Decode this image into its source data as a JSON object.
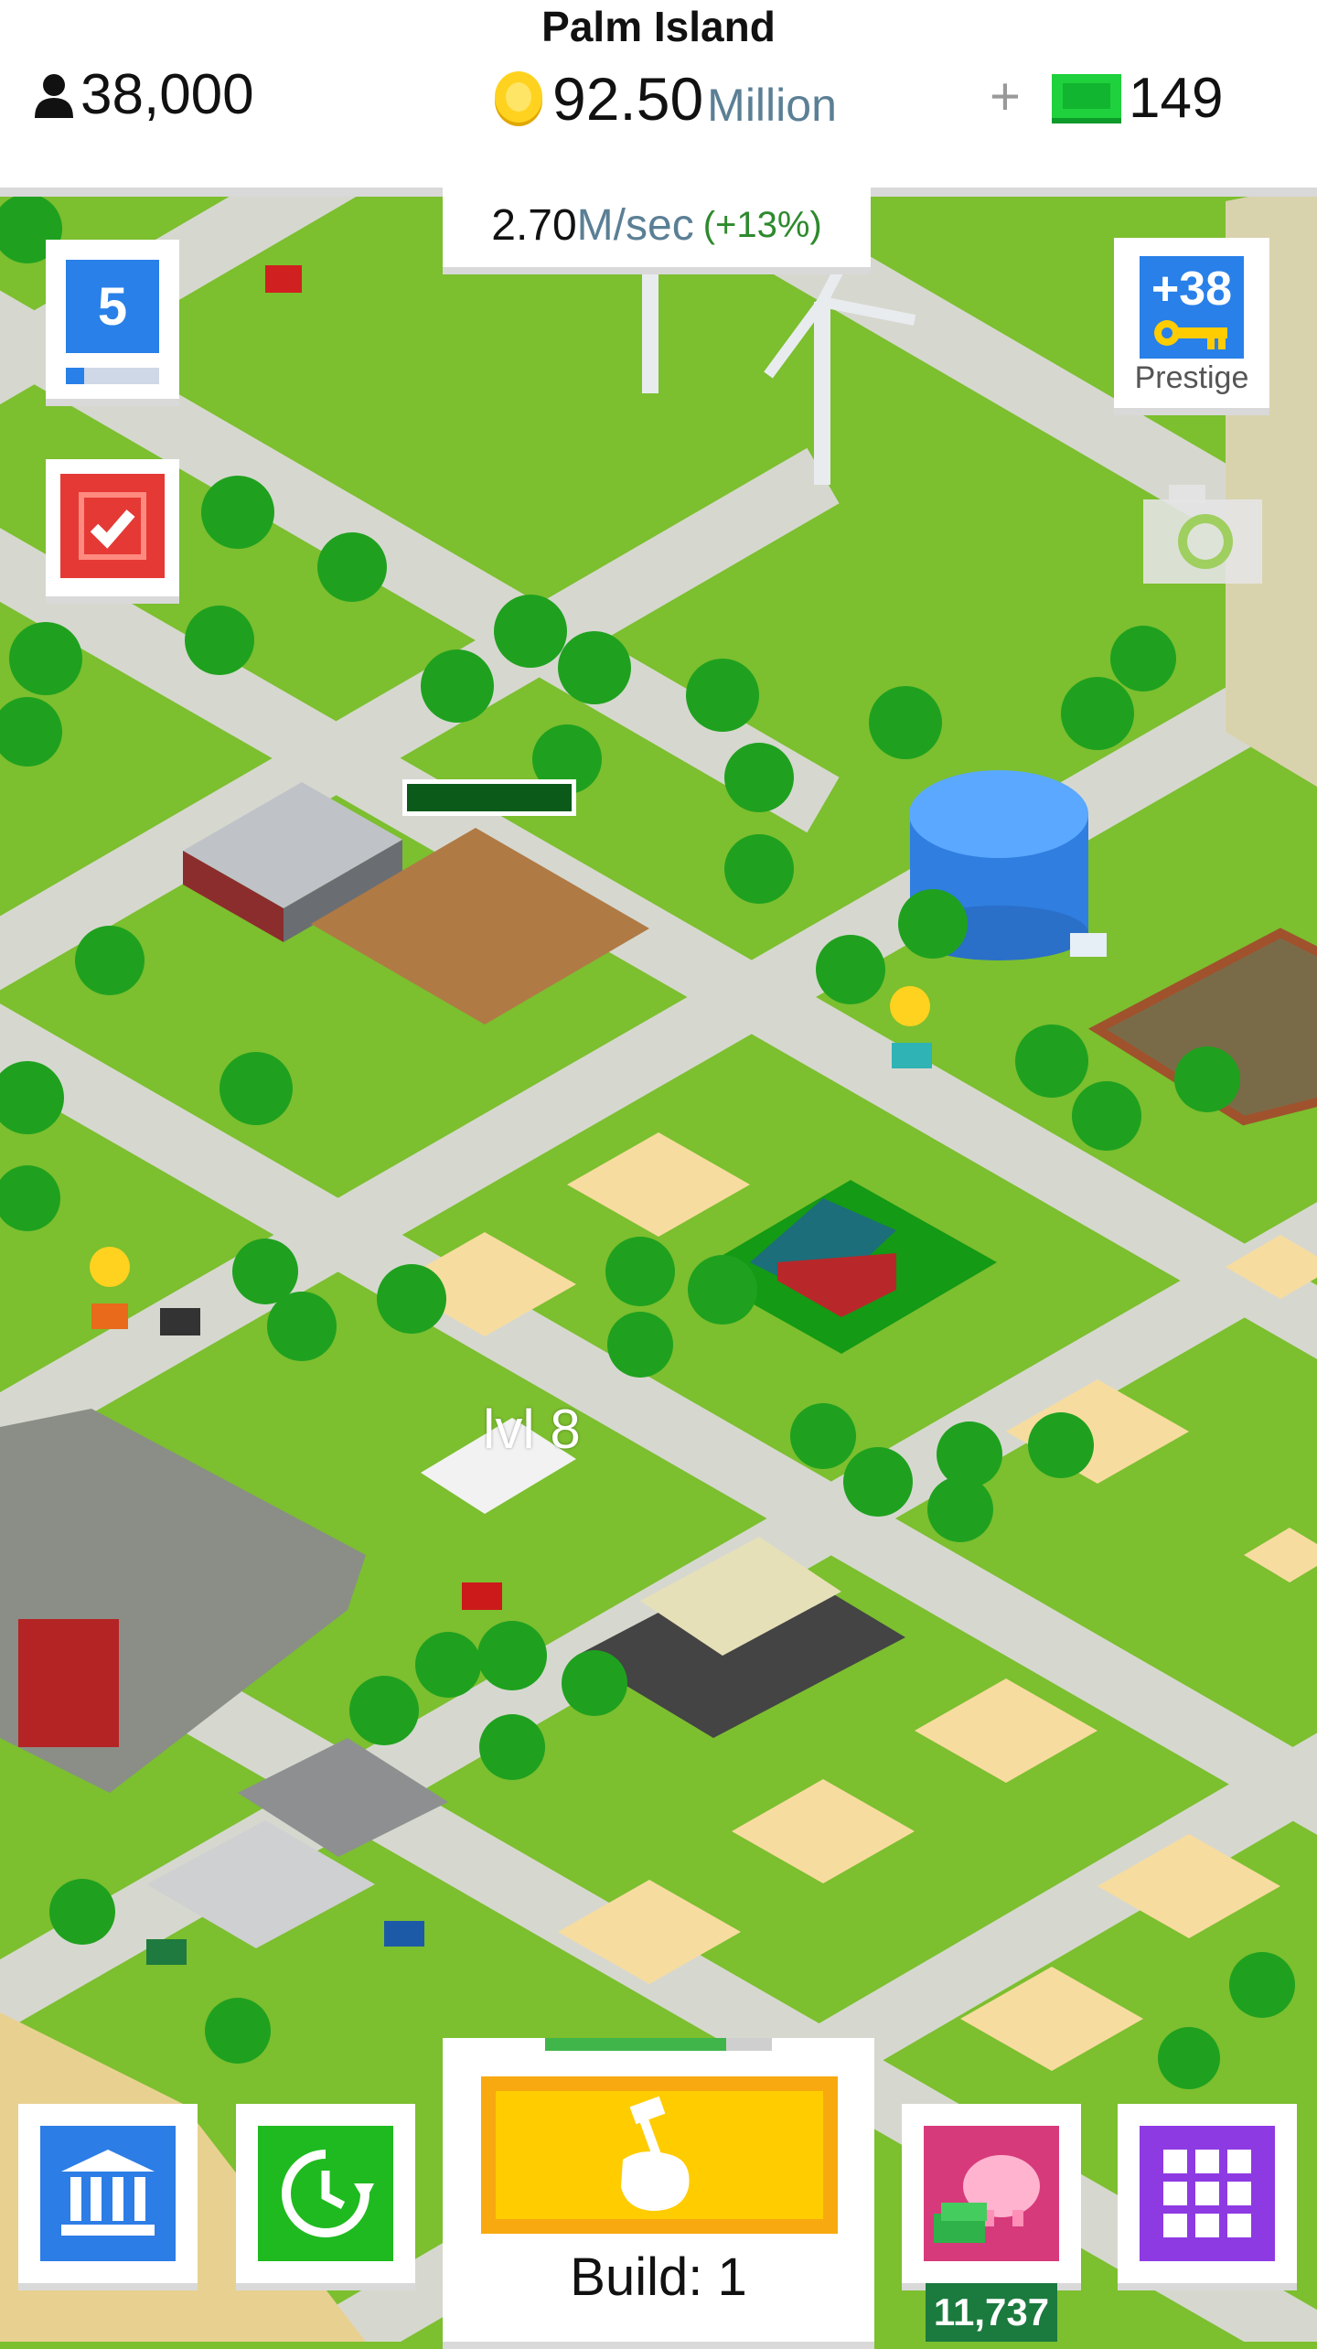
{
  "header": {
    "island_name": "Palm Island",
    "population": "38,000",
    "coins_value": "92.50",
    "coins_unit": "Million",
    "plus_symbol": "+",
    "cash_value": "149"
  },
  "income": {
    "rate_value": "2.70",
    "rate_unit": "M/sec",
    "rate_bonus": "(+13%)"
  },
  "level": {
    "value": "5",
    "progress": 0.2
  },
  "prestige": {
    "bonus": "+38",
    "label": "Prestige"
  },
  "map": {
    "building_level_label": "lvl 8",
    "construction_progress": 1.0
  },
  "bottom_bar": {
    "build_label": "Build: 1",
    "build_progress": 0.8,
    "piggy_bank_amount": "11,737"
  },
  "colors": {
    "grass": "#7cbf2f",
    "road": "#d6d8cf",
    "sand": "#f7dca0",
    "level_blue": "#2980e8",
    "build_orange": "#f8a90f",
    "build_yellow": "#ffcc00",
    "piggy_pink": "#d73a7b",
    "menu_purple": "#8e3ae3",
    "boost_green": "#1fba1f"
  },
  "icons": {
    "population": "person-icon",
    "coins": "coin-icon",
    "cash": "cash-icon",
    "tasks": "checkmark-icon",
    "prestige": "key-icon",
    "camera": "camera-icon",
    "bank": "bank-icon",
    "boost": "clock-refresh-icon",
    "build": "hammer-hand-icon",
    "piggy": "piggy-bank-icon",
    "menu": "grid-icon"
  }
}
